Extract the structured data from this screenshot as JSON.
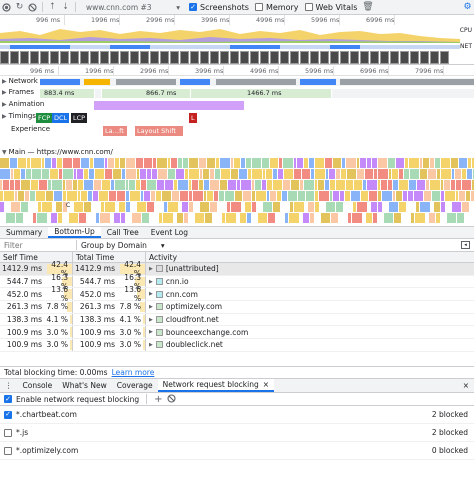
{
  "toolbar": {
    "url": "www.cnn.com #3",
    "screenshots_label": "Screenshots",
    "screenshots_checked": true,
    "memory_label": "Memory",
    "memory_checked": false,
    "web_vitals_label": "Web Vitals",
    "web_vitals_checked": false
  },
  "overview": {
    "ruler_ticks": [
      "996 ms",
      "1996 ms",
      "2996 ms",
      "3996 ms",
      "4996 ms",
      "5996 ms",
      "6996 ms"
    ],
    "cpu_label": "CPU",
    "net_label": "NET"
  },
  "timeline": {
    "ruler_ticks": [
      "996 ms",
      "1996 ms",
      "2996 ms",
      "3996 ms",
      "4996 ms",
      "5996 ms",
      "6996 ms",
      "7996 ms"
    ],
    "tracks": {
      "network": "Network",
      "frames": "Frames",
      "frames_values": [
        "883.4 ms",
        "866.7 ms",
        "1466.7 ms"
      ],
      "animation": "Animation",
      "timings": "Timings",
      "timing_markers": [
        "FCP",
        "DCL",
        "LCP",
        "L"
      ],
      "experience": "Experience",
      "experience_items": [
        "La…ft",
        "Layout Shift"
      ],
      "main": "Main — https://www.cnn.com/",
      "flame_marker": "C"
    }
  },
  "details": {
    "tabs": [
      "Summary",
      "Bottom-Up",
      "Call Tree",
      "Event Log"
    ],
    "active_tab": "Bottom-Up",
    "filter_placeholder": "Filter",
    "group_by": "Group by Domain",
    "columns": [
      "Self Time",
      "Total Time",
      "Activity"
    ],
    "rows": [
      {
        "self": "1412.9 ms",
        "self_pct": "42.4 %",
        "self_frac": 0.424,
        "total": "1412.9 ms",
        "total_pct": "42.4 %",
        "total_frac": 0.424,
        "activity": "[unattributed]",
        "color": "#dadce0"
      },
      {
        "self": "544.7 ms",
        "self_pct": "16.3 %",
        "self_frac": 0.163,
        "total": "544.7 ms",
        "total_pct": "16.3 %",
        "total_frac": 0.163,
        "activity": "cnn.io",
        "color": "#b2ebf2"
      },
      {
        "self": "452.0 ms",
        "self_pct": "13.6 %",
        "self_frac": 0.136,
        "total": "452.0 ms",
        "total_pct": "13.6 %",
        "total_frac": 0.136,
        "activity": "cnn.com",
        "color": "#b2ebf2"
      },
      {
        "self": "261.3 ms",
        "self_pct": "7.8 %",
        "self_frac": 0.078,
        "total": "261.3 ms",
        "total_pct": "7.8 %",
        "total_frac": 0.078,
        "activity": "optimizely.com",
        "color": "#c8e6c9"
      },
      {
        "self": "138.3 ms",
        "self_pct": "4.1 %",
        "self_frac": 0.041,
        "total": "138.3 ms",
        "total_pct": "4.1 %",
        "total_frac": 0.041,
        "activity": "cloudfront.net",
        "color": "#c8e6c9"
      },
      {
        "self": "100.9 ms",
        "self_pct": "3.0 %",
        "self_frac": 0.03,
        "total": "100.9 ms",
        "total_pct": "3.0 %",
        "total_frac": 0.03,
        "activity": "bounceexchange.com",
        "color": "#c8e6c9"
      },
      {
        "self": "100.9 ms",
        "self_pct": "3.0 %",
        "self_frac": 0.03,
        "total": "100.9 ms",
        "total_pct": "3.0 %",
        "total_frac": 0.03,
        "activity": "doubleclick.net",
        "color": "#c8e6c9"
      }
    ]
  },
  "footer": {
    "tbt_text": "Total blocking time: 0.00ms",
    "learn_more": "Learn more"
  },
  "drawer": {
    "tabs": [
      "Console",
      "What's New",
      "Coverage",
      "Network request blocking"
    ],
    "active_tab": "Network request blocking",
    "enable_label": "Enable network request blocking",
    "enable_checked": true,
    "patterns": [
      {
        "pattern": "*.chartbeat.com",
        "checked": true,
        "count": "2 blocked"
      },
      {
        "pattern": "*.js",
        "checked": false,
        "count": "2 blocked"
      },
      {
        "pattern": "*.optimizely.com",
        "checked": false,
        "count": "0 blocked"
      }
    ]
  }
}
